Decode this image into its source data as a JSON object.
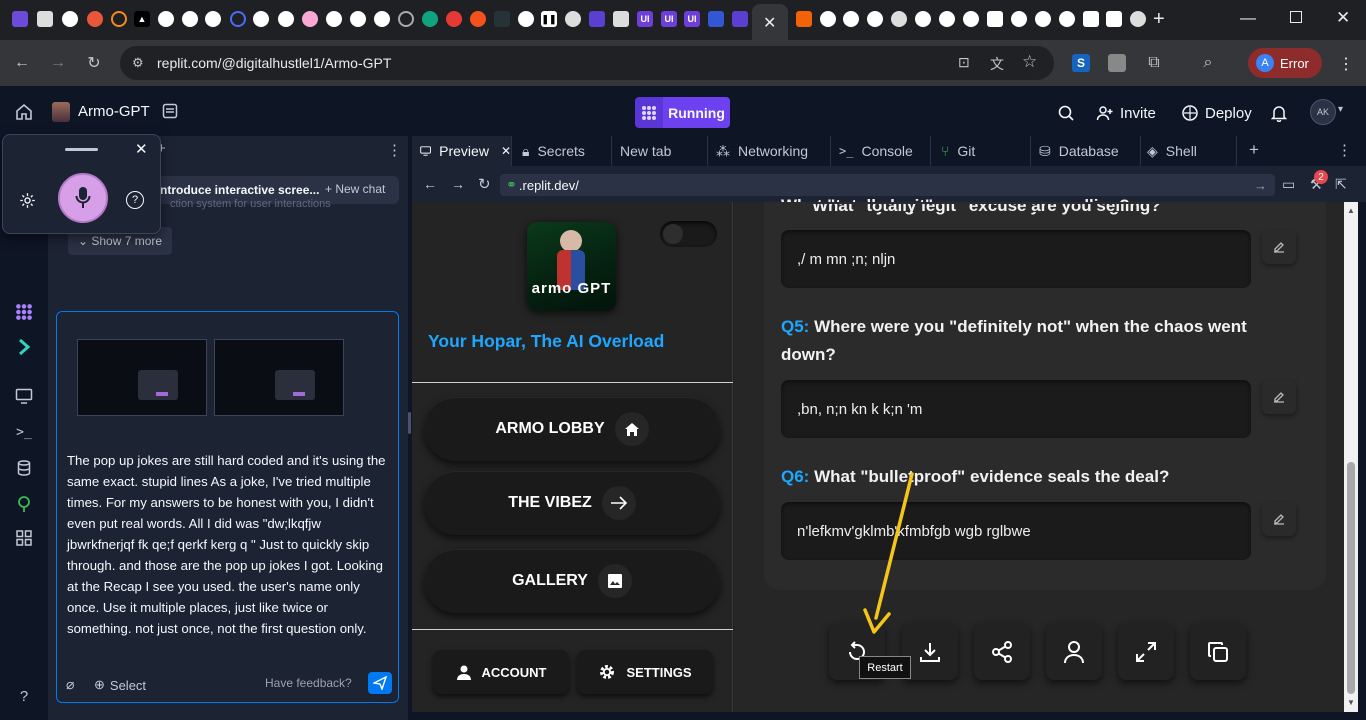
{
  "browser": {
    "url": "replit.com/@digitalhustlel1/Armo-GPT",
    "profile_label": "Error",
    "profile_initial": "A",
    "new_tab_symbol": "+"
  },
  "header": {
    "project_name": "Armo-GPT",
    "run_status": "Running",
    "invite_label": "Invite",
    "deploy_label": "Deploy",
    "avatar_initials": "AK"
  },
  "chat": {
    "pill_text": "ntroduce interactive scree...",
    "pill_sub": "ction system for user interactions",
    "new_chat_label": "New chat",
    "show_more_label": "Show 7 more",
    "message": "The pop up jokes are still hard coded and it's using the same exact. stupid lines As a joke, I've tried multiple times.  For my answers to be honest with you, I didn't even put real words. All I did was \"dw;lkqfjw  jbwrkfnerjqf fk qe;f qerkf kerg q   \"  Just to quickly skip through. and those are the pop up jokes I got. Looking at the Recap I see you used. the user's name only once. Use it multiple places, just like twice or something. not just once, not the first question only.",
    "select_label": "Select",
    "feedback_label": "Have feedback?"
  },
  "workspace": {
    "tabs": [
      {
        "label": "Preview"
      },
      {
        "label": "Secrets"
      },
      {
        "label": "New tab"
      },
      {
        "label": "Networking"
      },
      {
        "label": "Console"
      },
      {
        "label": "Git"
      },
      {
        "label": "Database"
      },
      {
        "label": "Shell"
      }
    ],
    "preview_url": ".replit.dev/",
    "notification_count": "2"
  },
  "app": {
    "logo_text": "armo GPT",
    "tagline": "Your Hopar, The AI Overload",
    "nav": [
      {
        "label": "ARMO LOBBY"
      },
      {
        "label": "THE VIBEZ"
      },
      {
        "label": "GALLERY"
      }
    ],
    "account_label": "ACCOUNT",
    "settings_label": "SETTINGS",
    "questions": [
      {
        "num": "",
        "text": "What \"totally legit\" excuse are you selling?",
        "answer": ",/ m mn ;n; nljn"
      },
      {
        "num": "Q5:",
        "text": "Where were you \"definitely not\" when the chaos went down?",
        "answer": ",bn, n;n kn k k;n 'm"
      },
      {
        "num": "Q6:",
        "text": "What \"bulletproof\" evidence seals the deal?",
        "answer": "n'lefkmv'gklmb'kfmbfgb wgb rglbwe"
      }
    ],
    "tooltip": "Restart"
  },
  "colors": {
    "replit_bg": "#0e1525",
    "panel_bg": "#1c2333",
    "running_purple": "#6d41ef",
    "question_blue": "#1ea7ff",
    "tagline_blue": "#1ea7ff",
    "arrow_yellow": "#f5c518"
  }
}
